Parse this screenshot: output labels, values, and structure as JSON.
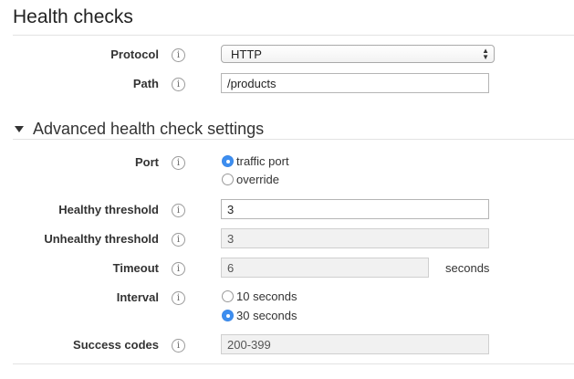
{
  "section": {
    "title": "Health checks"
  },
  "protocol": {
    "label": "Protocol",
    "info_icon": "info-icon",
    "value": "HTTP",
    "arrows": "▲\n▼"
  },
  "path": {
    "label": "Path",
    "info_icon": "info-icon",
    "value": "/products"
  },
  "advanced": {
    "title": "Advanced health check settings",
    "expanded": true
  },
  "port": {
    "label": "Port",
    "info_icon": "info-icon",
    "options": [
      {
        "label": "traffic port",
        "checked": true
      },
      {
        "label": "override",
        "checked": false
      }
    ]
  },
  "healthy_threshold": {
    "label": "Healthy threshold",
    "info_icon": "info-icon",
    "value": "3"
  },
  "unhealthy_threshold": {
    "label": "Unhealthy threshold",
    "info_icon": "info-icon",
    "value": "3"
  },
  "timeout": {
    "label": "Timeout",
    "info_icon": "info-icon",
    "value": "6",
    "unit": "seconds"
  },
  "interval": {
    "label": "Interval",
    "info_icon": "info-icon",
    "options": [
      {
        "label": "10 seconds",
        "checked": false
      },
      {
        "label": "30 seconds",
        "checked": true
      }
    ]
  },
  "success_codes": {
    "label": "Success codes",
    "info_icon": "info-icon",
    "value": "200-399"
  },
  "colors": {
    "radio_checked": "#3d8ef0",
    "disabled_field_bg": "#f1f1f1",
    "rule": "#e2e2e2"
  }
}
